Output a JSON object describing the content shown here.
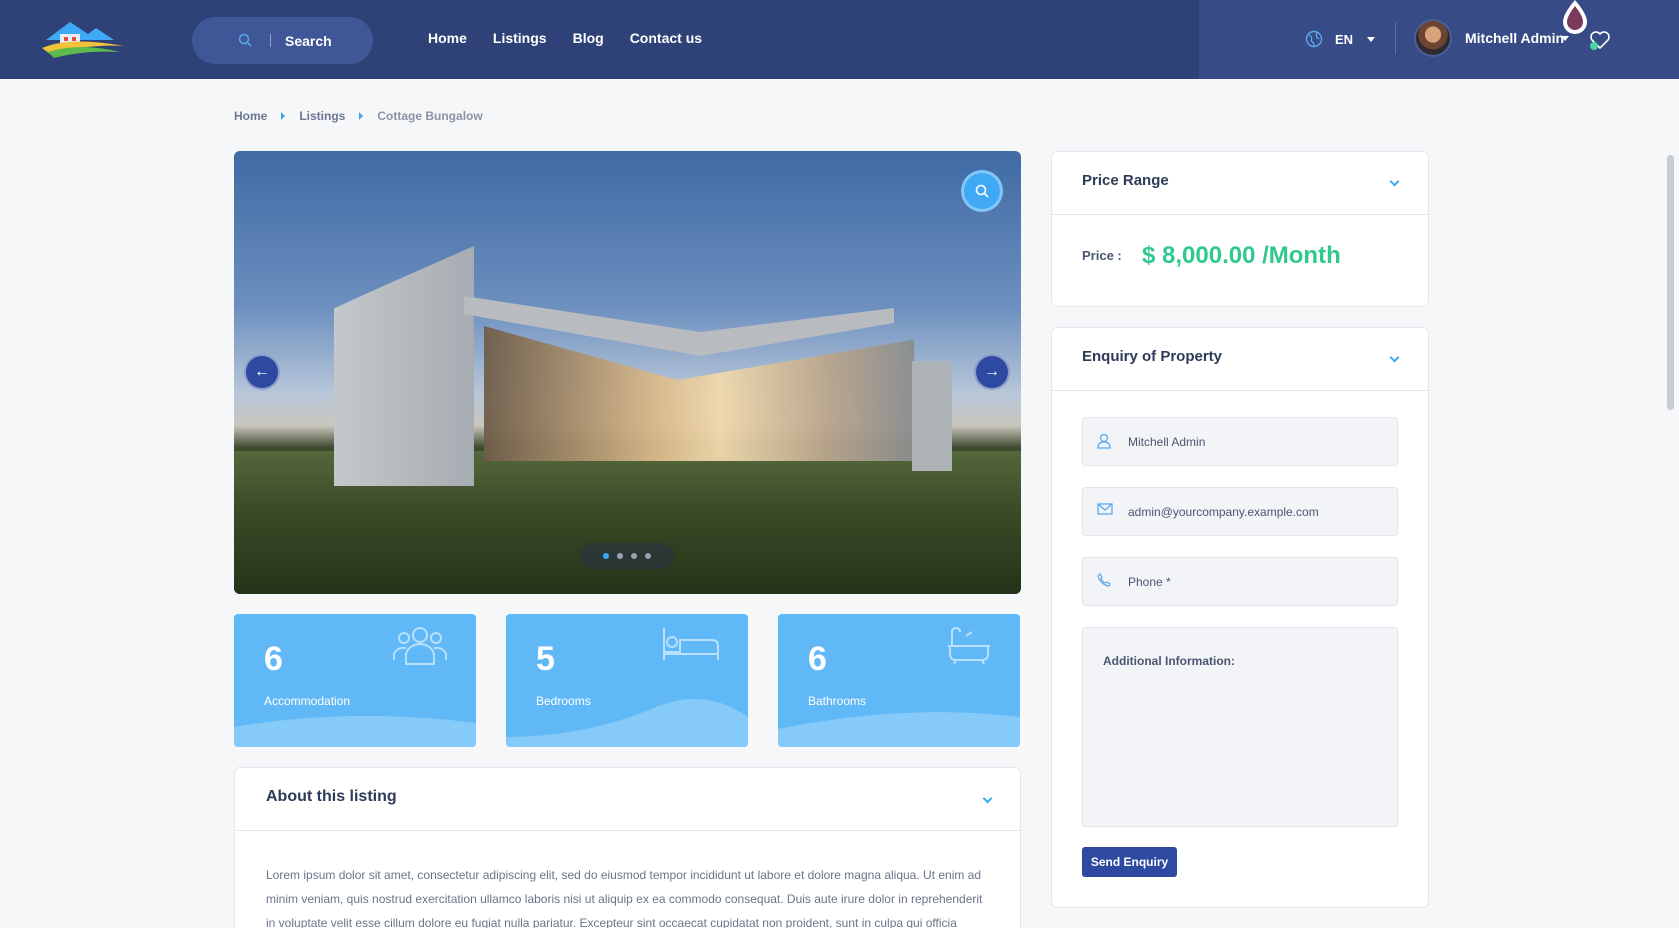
{
  "header": {
    "search_label": "Search",
    "nav": [
      "Home",
      "Listings",
      "Blog",
      "Contact us"
    ],
    "language": "EN",
    "user_name": "Mitchell Admin"
  },
  "breadcrumb": [
    "Home",
    "Listings",
    "Cottage Bungalow"
  ],
  "gallery": {
    "slide_count": 4,
    "active_slide": 1
  },
  "stats": [
    {
      "value": "6",
      "label": "Accommodation",
      "icon": "people-icon"
    },
    {
      "value": "5",
      "label": "Bedrooms",
      "icon": "bed-icon"
    },
    {
      "value": "6",
      "label": "Bathrooms",
      "icon": "bathtub-icon"
    }
  ],
  "about": {
    "title": "About this listing",
    "text": "Lorem ipsum dolor sit amet, consectetur adipiscing elit, sed do eiusmod tempor incididunt ut labore et dolore magna aliqua. Ut enim ad minim veniam, quis nostrud exercitation ullamco laboris nisi ut aliquip ex ea commodo consequat. Duis aute irure dolor in reprehenderit in voluptate velit esse cillum dolore eu fugiat nulla pariatur. Excepteur sint occaecat cupidatat non proident, sunt in culpa qui officia"
  },
  "price": {
    "title": "Price Range",
    "label": "Price :",
    "value": "$ 8,000.00 /Month"
  },
  "enquiry": {
    "title": "Enquiry of Property",
    "name_value": "Mitchell Admin",
    "email_value": "admin@yourcompany.example.com",
    "phone_placeholder": "Phone *",
    "info_placeholder": "Additional Information:",
    "submit_label": "Send Enquiry"
  },
  "colors": {
    "header_bg": "#2e4277",
    "accent": "#3fa9f5",
    "price_green": "#2fc98e",
    "button_blue": "#2d4aa0",
    "stat_blue": "#61b8f6"
  }
}
